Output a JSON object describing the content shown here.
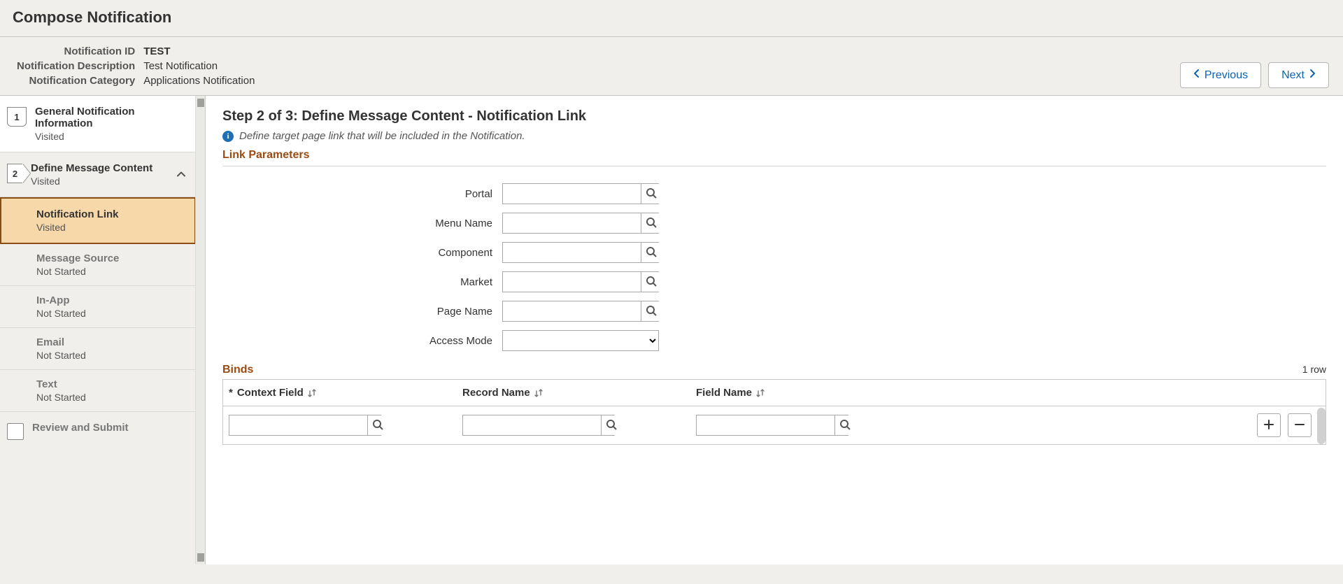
{
  "header": {
    "page_title": "Compose Notification",
    "fields": {
      "id_label": "Notification ID",
      "id_value": "TEST",
      "desc_label": "Notification Description",
      "desc_value": "Test Notification",
      "cat_label": "Notification Category",
      "cat_value": "Applications Notification"
    },
    "prev_label": "Previous",
    "next_label": "Next"
  },
  "sidebar": {
    "step1": {
      "num": "1",
      "title": "General Notification Information",
      "status": "Visited"
    },
    "step2": {
      "num": "2",
      "title": "Define Message Content",
      "status": "Visited"
    },
    "sub": {
      "link": {
        "title": "Notification Link",
        "status": "Visited"
      },
      "source": {
        "title": "Message Source",
        "status": "Not Started"
      },
      "inapp": {
        "title": "In-App",
        "status": "Not Started"
      },
      "email": {
        "title": "Email",
        "status": "Not Started"
      },
      "text": {
        "title": "Text",
        "status": "Not Started"
      }
    },
    "step3": {
      "title": "Review and Submit"
    }
  },
  "main": {
    "title": "Step 2 of 3: Define Message Content - Notification Link",
    "hint": "Define target page link that will be included in the Notification.",
    "section_link_params": "Link Parameters",
    "labels": {
      "portal": "Portal",
      "menu": "Menu Name",
      "component": "Component",
      "market": "Market",
      "page": "Page Name",
      "access": "Access Mode"
    },
    "values": {
      "portal": "",
      "menu": "",
      "component": "",
      "market": "",
      "page": "",
      "access": ""
    },
    "binds_head": "Binds",
    "row_count": "1 row",
    "grid": {
      "col1": "Context Field",
      "col1_req": "*",
      "col2": "Record Name",
      "col3": "Field Name",
      "row": {
        "context": "",
        "record": "",
        "field": ""
      }
    }
  }
}
